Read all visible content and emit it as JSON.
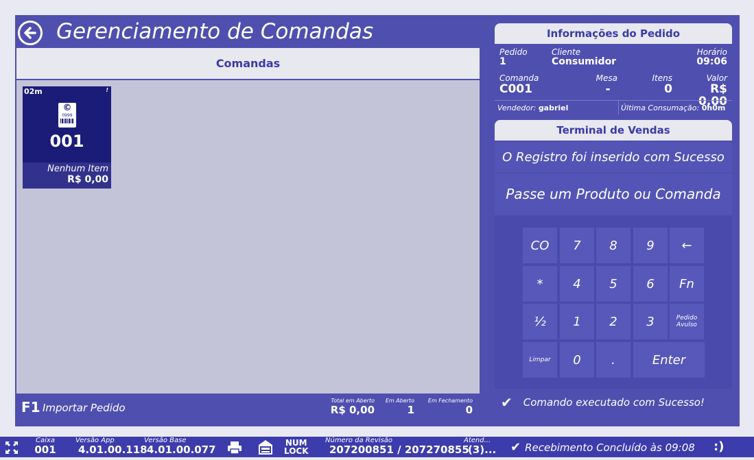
{
  "header": {
    "title": "Gerenciamento de Comandas"
  },
  "comandas": {
    "title": "Comandas",
    "card": {
      "time": "02m",
      "flag": "!",
      "badge_top": "©",
      "badge_num": "0999",
      "number": "001",
      "items": "Nenhum Item",
      "value": "R$ 0,00"
    }
  },
  "footer": {
    "f1_key": "F1",
    "f1_label": "Importar Pedido",
    "total_label": "Total em Aberto",
    "total_value": "R$ 0,00",
    "aberto_label": "Em Aberto",
    "aberto_value": "1",
    "fechamento_label": "Em Fechamento",
    "fechamento_value": "0"
  },
  "info": {
    "title": "Informações do Pedido",
    "pedido_label": "Pedido",
    "pedido_value": "1",
    "cliente_label": "Cliente",
    "cliente_value": "Consumidor",
    "horario_label": "Horário",
    "horario_value": "09:06",
    "comanda_label": "Comanda",
    "comanda_value": "C001",
    "mesa_label": "Mesa",
    "mesa_value": "-",
    "itens_label": "Itens",
    "itens_value": "0",
    "valor_label": "Valor",
    "valor_value": "R$ 0,00",
    "vendedor_label": "Vendedor:",
    "vendedor_value": "gabriel",
    "ultima_label": "Última Consumação:",
    "ultima_value": "0h0m"
  },
  "terminal": {
    "title": "Terminal de Vendas",
    "message1": "O Registro foi inserido com Sucesso",
    "message2": "Passe um Produto ou Comanda",
    "keys": [
      "CO",
      "7",
      "8",
      "9",
      "←",
      "*",
      "4",
      "5",
      "6",
      "Fn",
      "½",
      "1",
      "2",
      "3",
      "Pedido Avulso",
      "Limpar",
      "0",
      ".",
      "Enter"
    ],
    "status": "Comando executado com Sucesso!"
  },
  "statusbar": {
    "caixa_label": "Caixa",
    "caixa_value": "001",
    "app_label": "Versão App",
    "app_value": "4.01.00.118",
    "base_label": "Versão Base",
    "base_value": "4.01.00.077",
    "numlock_top": "NUM",
    "numlock_bottom": "LOCK",
    "revisao_label": "Número da Revisão",
    "revisao_value": "207200851 / 207270855",
    "atend_label": "Atend...",
    "atend_value": "(3)...",
    "message": "Recebimento Concluído às 09:08",
    "smiley": ":)"
  },
  "colors": {
    "panel": "#4f4fb0",
    "card": "#1b1b78",
    "content": "#c4c4d9",
    "header_text": "#3a3aa8"
  }
}
